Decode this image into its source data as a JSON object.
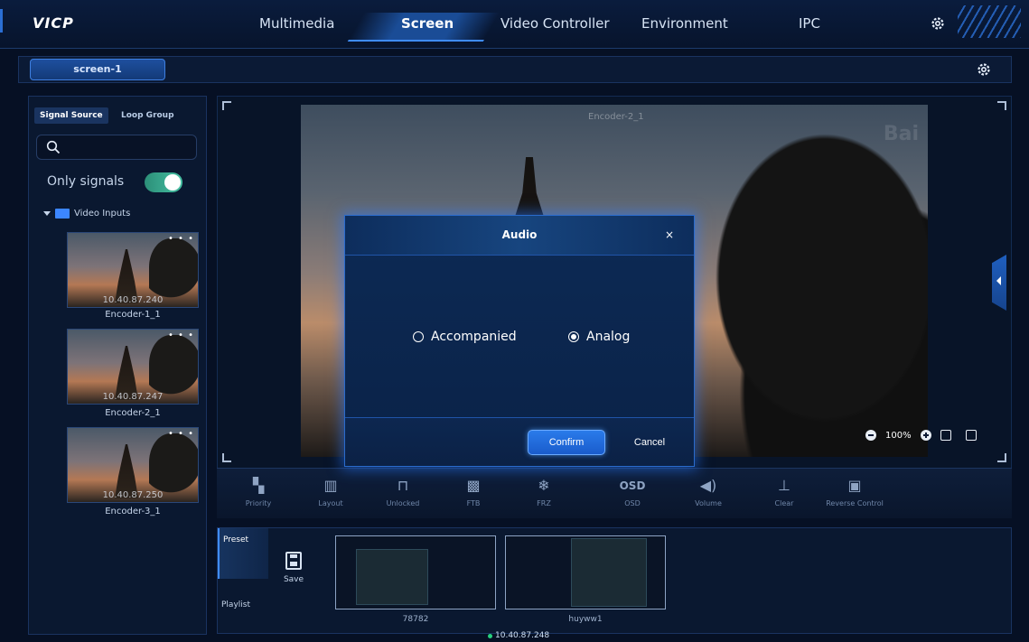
{
  "app": {
    "logo": "VICP",
    "nav": [
      "Multimedia",
      "Screen",
      "Video Controller",
      "Environment",
      "IPC"
    ],
    "active_nav": "Screen"
  },
  "screen_tab": {
    "label": "screen-1"
  },
  "sidebar": {
    "tabs": [
      "Signal Source",
      "Loop Group"
    ],
    "search": {
      "value": "",
      "placeholder": ""
    },
    "only_signals": {
      "label": "Only signals",
      "enabled": true
    },
    "tree": {
      "label": "Video Inputs"
    },
    "signals": [
      {
        "ip": "10.40.87.240",
        "name": "Encoder-1_1"
      },
      {
        "ip": "10.40.87.247",
        "name": "Encoder-2_1"
      },
      {
        "ip": "10.40.87.250",
        "name": "Encoder-3_1"
      }
    ]
  },
  "stage": {
    "window_label": "Encoder-2_1",
    "zoom": "100%"
  },
  "toolbar": [
    {
      "label": "Priority",
      "icon": "priority-icon"
    },
    {
      "label": "Layout",
      "icon": "layout-icon"
    },
    {
      "label": "Unlocked",
      "icon": "unlock-icon"
    },
    {
      "label": "FTB",
      "icon": "ftb-icon"
    },
    {
      "label": "FRZ",
      "icon": "snowflake-icon"
    },
    {
      "label": "OSD",
      "icon": "osd-icon"
    },
    {
      "label": "Volume",
      "icon": "volume-icon"
    },
    {
      "label": "Clear",
      "icon": "clear-icon"
    },
    {
      "label": "Reverse Control",
      "icon": "reverse-control-icon"
    }
  ],
  "bottom": {
    "tabs": [
      "Preset",
      "Playlist"
    ],
    "save_label": "Save",
    "presets": [
      "78782",
      "huyww1"
    ],
    "status_ip": "10.40.87.248"
  },
  "dialog": {
    "title": "Audio",
    "close": "×",
    "options": [
      {
        "label": "Accompanied",
        "selected": false
      },
      {
        "label": "Analog",
        "selected": true
      }
    ],
    "confirm_label": "Confirm",
    "cancel_label": "Cancel"
  },
  "colors": {
    "accent": "#2a7bea",
    "background": "#061024",
    "toggle_on": "#46c0a3",
    "status_online": "#27d17f"
  }
}
